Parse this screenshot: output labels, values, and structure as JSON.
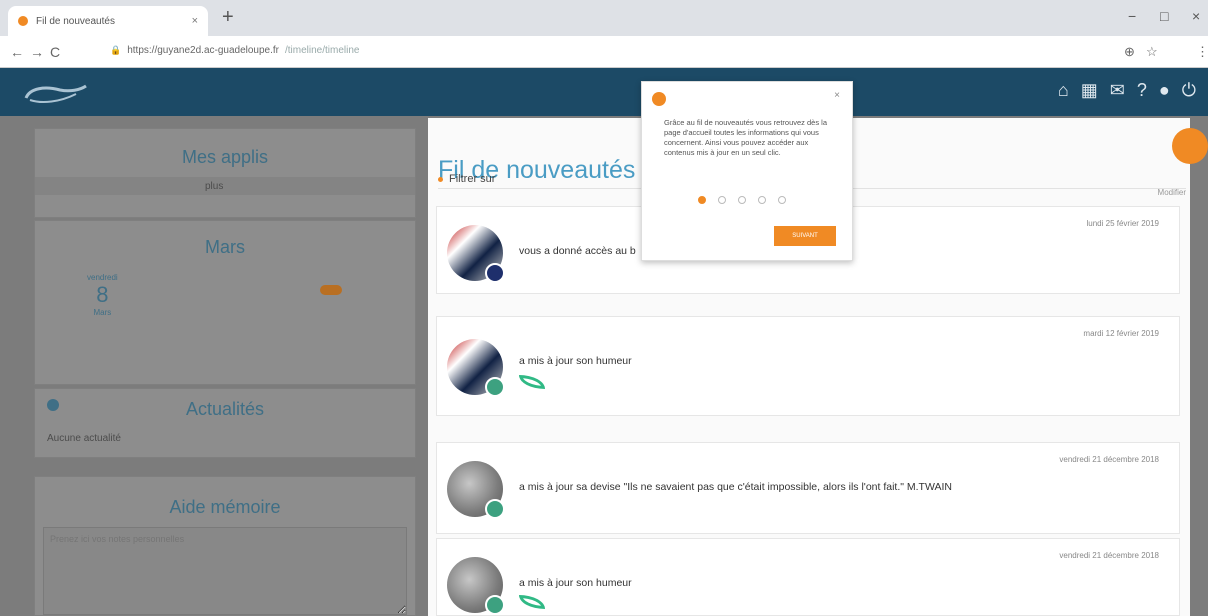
{
  "browser": {
    "tab_title": "Fil de nouveautés",
    "new_tab": "+",
    "close_tab": "×",
    "url_domain": "https://guyane2d.ac-guadeloupe.fr",
    "url_path": "/timeline/timeline",
    "window_controls": [
      "−",
      "□",
      "×"
    ],
    "nav": [
      "←",
      "→",
      "C"
    ],
    "right_icons": [
      "⊕",
      "☆",
      "⋮"
    ]
  },
  "app": {
    "header_icons": [
      "home-icon",
      "apps-grid-icon",
      "mail-icon",
      "help-icon",
      "user-icon",
      "power-icon"
    ]
  },
  "left": {
    "apps_title": "Mes applis",
    "apps_item": "plus",
    "calendar": {
      "month": "Mars",
      "day_name": "vendredi",
      "day_number": "8",
      "month_short": "Mars"
    },
    "news_title": "Actualités",
    "news_item": "Aucune actualité",
    "memo_title": "Aide mémoire",
    "memo_placeholder": "Prenez ici vos notes personnelles"
  },
  "feed": {
    "title": "Fil de nouveautés",
    "filter_label": "Filtrer sur",
    "side_label": "Modifier",
    "posts": [
      {
        "date": "lundi 25 février 2019",
        "text": "vous a donné accès au b"
      },
      {
        "date": "mardi 12 février 2019",
        "text": "a mis à jour son humeur"
      },
      {
        "date": "vendredi 21 décembre 2018",
        "text": "a mis à jour sa devise \"Ils ne savaient pas que c'était impossible, alors ils l'ont fait.\" M.TWAIN"
      },
      {
        "date": "vendredi 21 décembre 2018",
        "text": "a mis à jour son humeur"
      }
    ]
  },
  "tooltip": {
    "text": "Grâce au fil de nouveautés vous retrouvez dès la page d'accueil toutes les informations qui vous concernent. Ainsi vous pouvez accéder aux contenus mis à jour en un seul clic.",
    "button": "SUIVANT",
    "close": "×"
  }
}
